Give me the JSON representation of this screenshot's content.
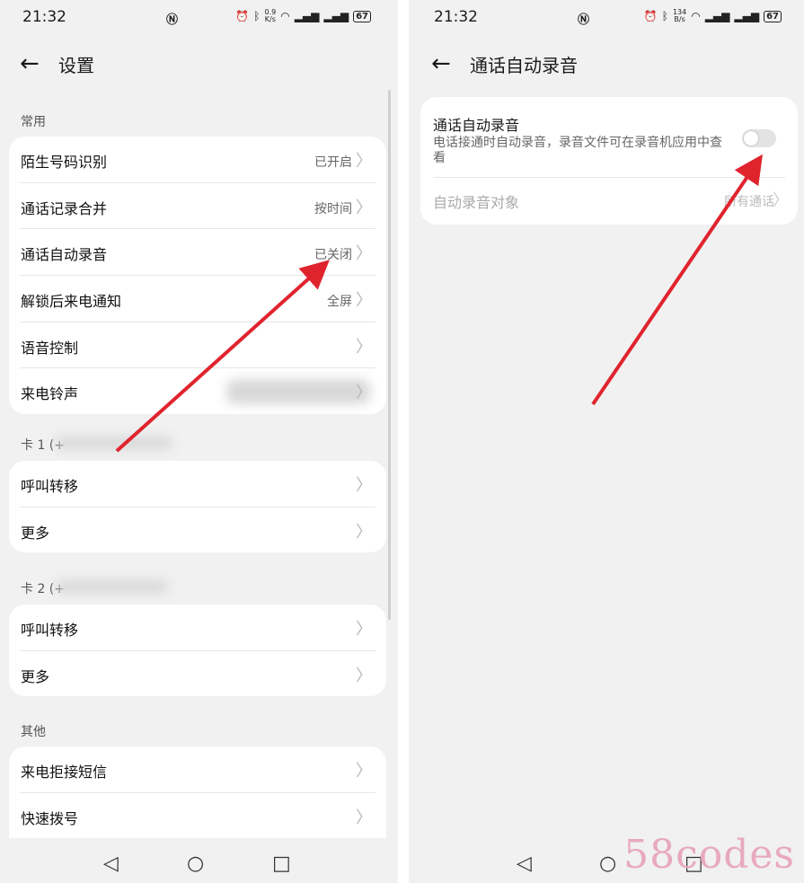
{
  "left": {
    "status": {
      "time": "21:32",
      "speed_value": "0.9",
      "speed_unit": "K/s",
      "battery": "67"
    },
    "header": {
      "title": "设置"
    },
    "sections": [
      {
        "title": "常用",
        "items": [
          {
            "label": "陌生号码识别",
            "value": "已开启"
          },
          {
            "label": "通话记录合并",
            "value": "按时间"
          },
          {
            "label": "通话自动录音",
            "value": "已关闭"
          },
          {
            "label": "解锁后来电通知",
            "value": "全屏"
          },
          {
            "label": "语音控制",
            "value": ""
          },
          {
            "label": "来电铃声",
            "value": ""
          }
        ]
      },
      {
        "title": "卡 1 (+",
        "items": [
          {
            "label": "呼叫转移",
            "value": ""
          },
          {
            "label": "更多",
            "value": ""
          }
        ]
      },
      {
        "title": "卡 2 (+",
        "items": [
          {
            "label": "呼叫转移",
            "value": ""
          },
          {
            "label": "更多",
            "value": ""
          }
        ]
      },
      {
        "title": "其他",
        "items": [
          {
            "label": "来电拒接短信",
            "value": ""
          },
          {
            "label": "快速拨号",
            "value": ""
          }
        ]
      }
    ]
  },
  "right": {
    "status": {
      "time": "21:32",
      "speed_value": "134",
      "speed_unit": "B/s",
      "battery": "67"
    },
    "header": {
      "title": "通话自动录音"
    },
    "setting": {
      "title": "通话自动录音",
      "description": "电话接通时自动录音，录音文件可在录音机应用中查看",
      "toggle_on": false,
      "sub_label": "自动录音对象",
      "sub_value": "所有通话"
    }
  },
  "watermark": "58codes",
  "icons": {
    "back": "back-arrow-icon",
    "chevron": "chevron-right-icon",
    "nav_back": "triangle-back-icon",
    "nav_home": "circle-home-icon",
    "nav_recent": "square-recent-icon"
  },
  "colors": {
    "arrow": "#e0242e",
    "background": "#f1f1f1",
    "card": "#ffffff"
  }
}
